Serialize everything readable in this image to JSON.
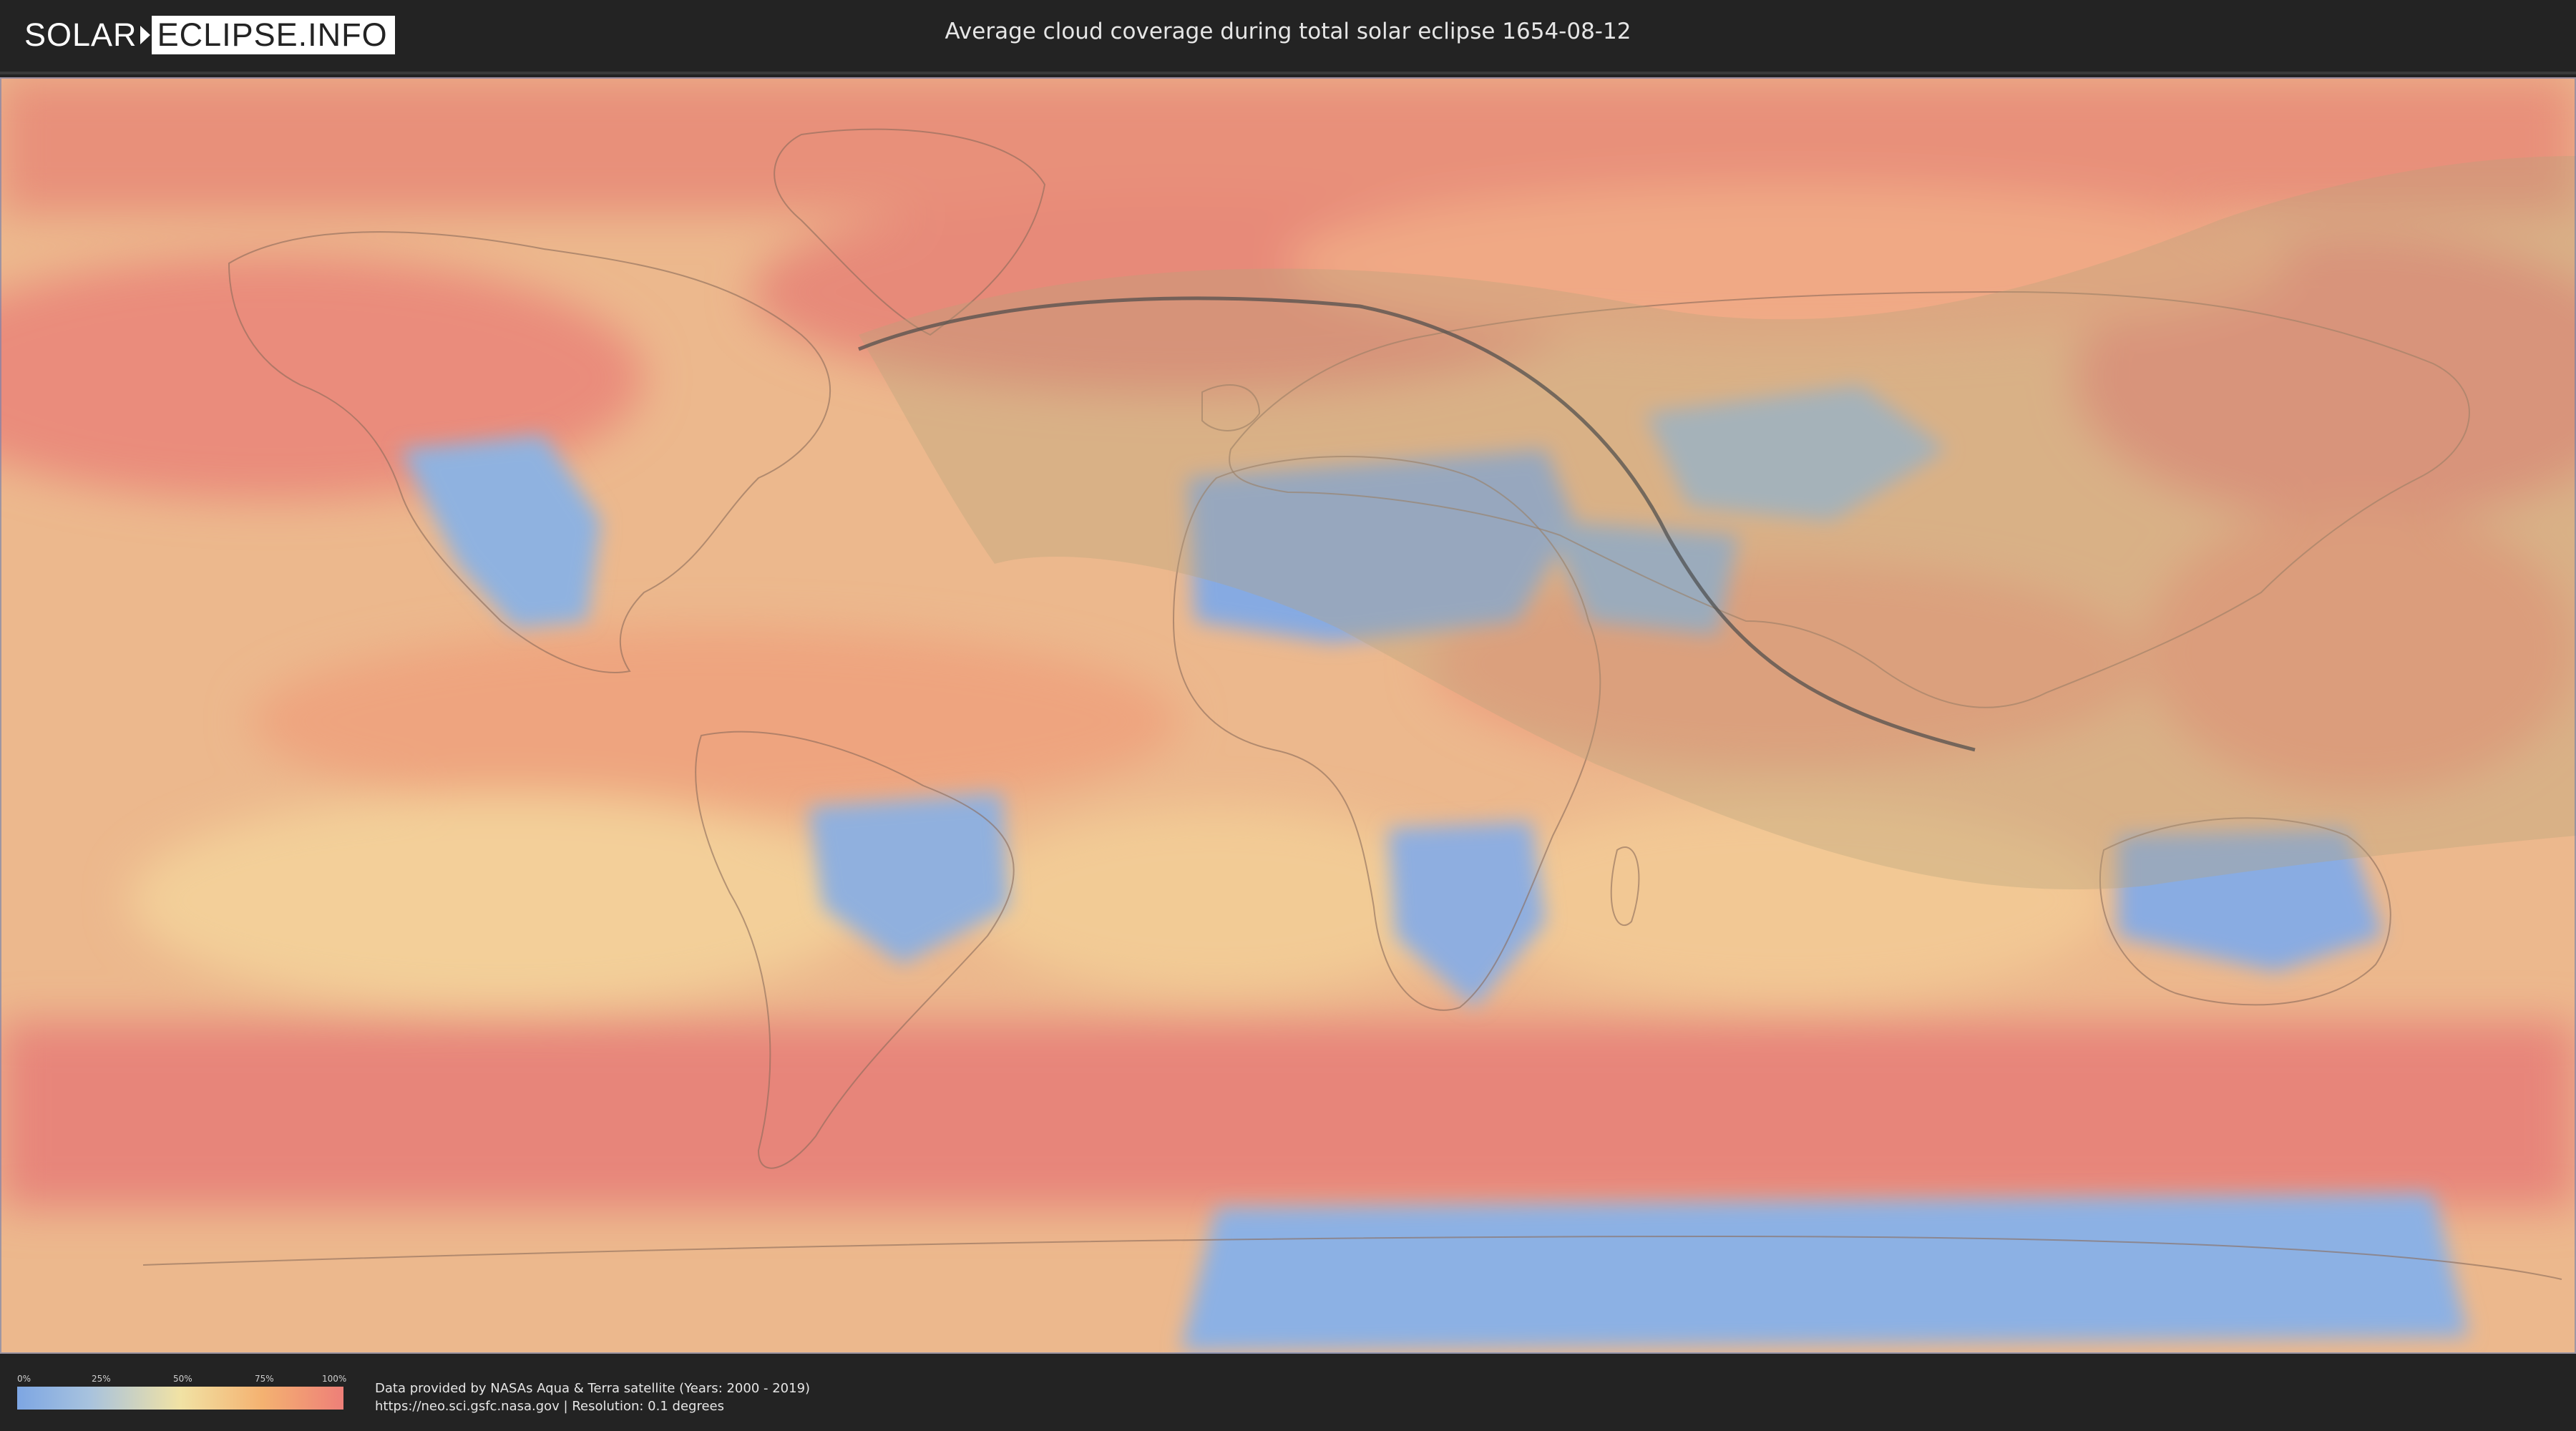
{
  "header": {
    "logo_part1": "SOLAR",
    "logo_part2": "ECLIPSE.INFO",
    "title": "Average cloud coverage during total solar eclipse 1654-08-12"
  },
  "map": {
    "legend": {
      "ticks": [
        "0%",
        "25%",
        "50%",
        "75%",
        "100%"
      ],
      "colors": [
        "#7da6e3",
        "#f1e2a4",
        "#f4b271",
        "#ee7f78"
      ]
    },
    "eclipse_path_color": "#4a4a4a",
    "eclipse_zone_color": "#b8a37c"
  },
  "footer": {
    "credit_line1": "Data provided by NASAs Aqua & Terra satellite (Years: 2000 - 2019)",
    "credit_line2": "https://neo.sci.gsfc.nasa.gov | Resolution: 0.1 degrees"
  }
}
